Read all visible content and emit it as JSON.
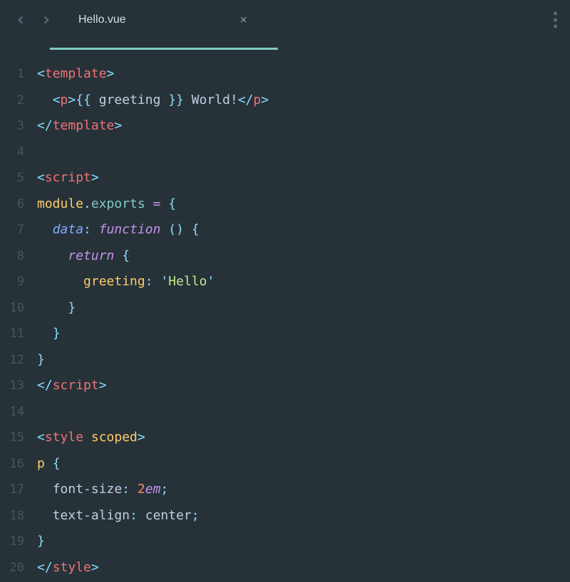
{
  "tab": {
    "title": "Hello.vue",
    "close": "×"
  },
  "gutter": {
    "l1": "1",
    "l2": "2",
    "l3": "3",
    "l4": "4",
    "l5": "5",
    "l6": "6",
    "l7": "7",
    "l8": "8",
    "l9": "9",
    "l10": "10",
    "l11": "11",
    "l12": "12",
    "l13": "13",
    "l14": "14",
    "l15": "15",
    "l16": "16",
    "l17": "17",
    "l18": "18",
    "l19": "19",
    "l20": "20"
  },
  "code": {
    "l1": {
      "open": "<",
      "tag": "template",
      "close": ">"
    },
    "l2": {
      "indent": "  ",
      "open": "<",
      "tag": "p",
      "close": ">",
      "mustache_open": "{{ ",
      "var": "greeting",
      "mustache_close": " }}",
      "text": " World!",
      "open2": "</",
      "tag2": "p",
      "close2": ">"
    },
    "l3": {
      "open": "</",
      "tag": "template",
      "close": ">"
    },
    "l4": {
      "blank": ""
    },
    "l5": {
      "open": "<",
      "tag": "script",
      "close": ">"
    },
    "l6": {
      "mod": "module",
      "dot": ".",
      "exp": "exports",
      "sp": " ",
      "eq": "=",
      "sp2": " ",
      "brace": "{"
    },
    "l7": {
      "indent": "  ",
      "prop": "data",
      "colon": ":",
      "sp": " ",
      "fn": "function",
      "sp2": " ",
      "paren": "()",
      "sp3": " ",
      "brace": "{"
    },
    "l8": {
      "indent": "    ",
      "ret": "return",
      "sp": " ",
      "brace": "{"
    },
    "l9": {
      "indent": "      ",
      "prop": "greeting",
      "colon": ":",
      "sp": " ",
      "q1": "'",
      "str": "Hello",
      "q2": "'"
    },
    "l10": {
      "indent": "    ",
      "brace": "}"
    },
    "l11": {
      "indent": "  ",
      "brace": "}"
    },
    "l12": {
      "brace": "}"
    },
    "l13": {
      "open": "</",
      "tag": "script",
      "close": ">"
    },
    "l14": {
      "blank": ""
    },
    "l15": {
      "open": "<",
      "tag": "style",
      "sp": " ",
      "attr": "scoped",
      "close": ">"
    },
    "l16": {
      "sel": "p",
      "sp": " ",
      "brace": "{"
    },
    "l17": {
      "indent": "  ",
      "prop": "font-size",
      "colon": ":",
      "sp": " ",
      "num": "2",
      "unit": "em",
      "semi": ";"
    },
    "l18": {
      "indent": "  ",
      "prop": "text-align",
      "colon": ":",
      "sp": " ",
      "val": "center",
      "semi": ";"
    },
    "l19": {
      "brace": "}"
    },
    "l20": {
      "open": "</",
      "tag": "style",
      "close": ">"
    }
  }
}
